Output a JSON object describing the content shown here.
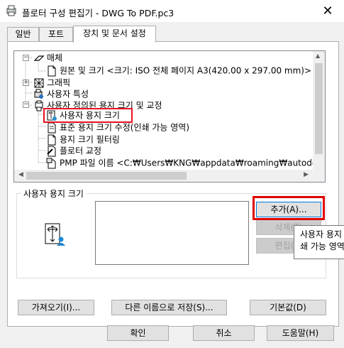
{
  "window": {
    "title": "플로터 구성 편집기 - DWG To PDF.pc3",
    "close_glyph": "✕"
  },
  "tabs": [
    {
      "label": "일반"
    },
    {
      "label": "포트"
    },
    {
      "label": "장치 및 문서 설정",
      "active": true
    }
  ],
  "tree": {
    "items": [
      {
        "label": "매체",
        "icon": "media-icon"
      },
      {
        "label": "원본 및 크기 <크기: ISO 전체 페이지 A3(420.00 x 297.00 mm)>",
        "icon": "page-icon"
      },
      {
        "label": "그래픽",
        "icon": "graphics-icon"
      },
      {
        "label": "사용자 특성",
        "icon": "user-props-icon"
      },
      {
        "label": "사용자 정의된 용지 크기 및 교정",
        "icon": "custom-paper-icon"
      },
      {
        "label": "사용자 용지 크기",
        "icon": "paper-size-icon",
        "selected": true
      },
      {
        "label": "표준 용지 크기 수정(인쇄 가능 영역)",
        "icon": "page-icon"
      },
      {
        "label": "용지 크기 필터링",
        "icon": "page-icon"
      },
      {
        "label": "플로터 교정",
        "icon": "calibration-icon"
      },
      {
        "label": "PMP 파일 이름 <C:₩Users₩KNG₩appdata₩roaming₩autode",
        "icon": "pmp-icon"
      }
    ]
  },
  "custom_paper_group": {
    "label": "사용자 용지 크기",
    "add_button": "추가(A)...",
    "delete_button": "삭제(T)",
    "edit_button": "편집(E)"
  },
  "tooltip": {
    "line1": "사용자 용지",
    "line2": "쇄 가능 영역"
  },
  "bottom_buttons": {
    "import": "가져오기(I)...",
    "save_as": "다른 이름으로 저장(S)...",
    "defaults": "기본값(D)"
  },
  "dialog_buttons": {
    "ok": "확인",
    "cancel": "취소",
    "help": "도움말(H)"
  },
  "colors": {
    "highlight_box": "#e00000",
    "selection_blue": "#0078d7"
  }
}
